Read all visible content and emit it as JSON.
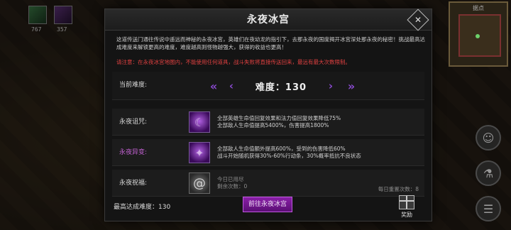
{
  "hud": {
    "item_count_1": "767",
    "item_count_2": "357",
    "minimap_label": "据点"
  },
  "dialog": {
    "title": "永夜冰宫",
    "description": "这道传送门通往传说中遥远而神秘的永夜冰宫，英雄们在夜幼龙的指引下，去那永夜的国度揭开冰宫深处那永夜的秘密！挑战最高达成难度来解锁更高的难度，难度越高则怪物越强大，获得的收益也更高！",
    "warning": "请注意：在永夜冰宫地图内，不能使用任何道具，战斗失败将直接传送回来，最远有最大次数限制。",
    "difficulty": {
      "label": "当前难度:",
      "value_text": "难度：130",
      "arrow_left_double": "«",
      "arrow_left": "‹",
      "arrow_right": "›",
      "arrow_right_double": "»"
    },
    "curse": {
      "label": "永夜诅咒:",
      "icon": "purple-curse-icon",
      "line1": "全部英雄生命值回复效果和法力值回复效果降低75%",
      "line2": "全部敌人生命值提高5400%，伤害提高1800%"
    },
    "mutation": {
      "label": "永夜异变:",
      "icon": "purple-mutation-icon",
      "line1": "全部敌人生命值额外提高600%，受到的伤害降低60%",
      "line2": "战斗开始随机获得30%-60%行动条，30%概率抵抗不良状态"
    },
    "blessing": {
      "label": "永夜祝福:",
      "icon": "swirl-icon",
      "line1": "今日已用尽",
      "line2": "剩余次数：0",
      "daily_reset": "每日重置次数：8"
    },
    "footer": {
      "highest": "最高达成难度：130",
      "go_button": "前往永夜冰宫",
      "reward_label": "奖励"
    }
  },
  "colors": {
    "accent_purple": "#8a4ad0",
    "warning_red": "#e04040",
    "mutation_label": "#c060d0"
  }
}
